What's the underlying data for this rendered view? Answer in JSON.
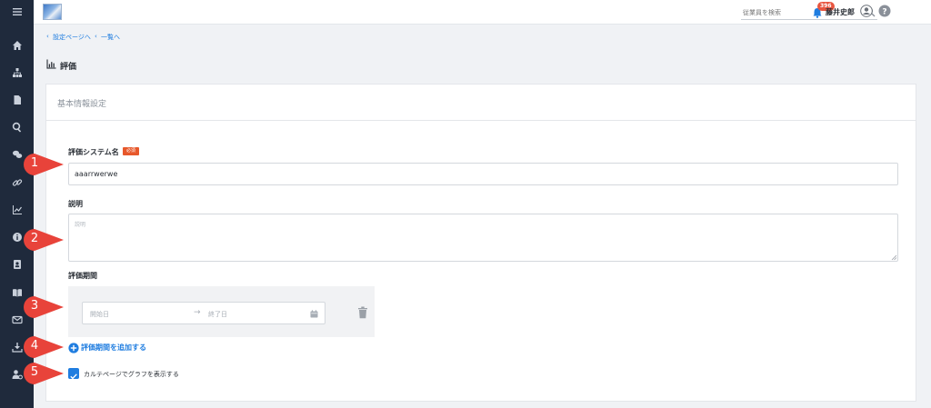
{
  "header": {
    "search_placeholder": "従業員を検索",
    "notification_count": "396",
    "user_name": "藤井史郎"
  },
  "breadcrumb": {
    "back_settings": "設定ページへ",
    "back_list": "一覧へ"
  },
  "page": {
    "title": "評価"
  },
  "card": {
    "title": "基本情報設定"
  },
  "form": {
    "system_name_label": "評価システム名",
    "required_badge": "必須",
    "system_name_value": "aaarrwerwe",
    "description_label": "説明",
    "description_placeholder": "説明",
    "period_label": "評価期間",
    "start_date_placeholder": "開始日",
    "end_date_placeholder": "終了日",
    "add_period_label": "評価期間を追加する",
    "show_graph_label": "カルテページでグラフを表示する",
    "show_graph_checked": true
  },
  "annotations": [
    "1",
    "2",
    "3",
    "4",
    "5"
  ],
  "colors": {
    "sidebar": "#1f2a3c",
    "accent": "#1f7de0",
    "required": "#e7582b",
    "marker": "#e8433a"
  },
  "sidebar": {
    "icons": [
      "menu-icon",
      "home-icon",
      "org-chart-icon",
      "document-icon",
      "search-icon",
      "chat-icon",
      "link-icon",
      "chart-icon",
      "info-icon",
      "contact-icon",
      "book-icon",
      "mail-icon",
      "download-icon",
      "user-settings-icon"
    ]
  }
}
